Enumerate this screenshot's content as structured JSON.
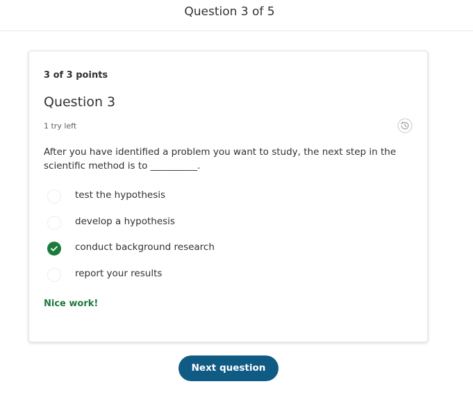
{
  "header": {
    "title": "Question 3 of 5"
  },
  "question": {
    "points": "3 of 3 points",
    "title": "Question 3",
    "tries": "1 try left",
    "prompt": "After you have identified a problem you want to study, the next step in the scientific method is to __________.",
    "history_icon": "history-icon",
    "options": [
      {
        "label": "test the hypothesis",
        "selected": false
      },
      {
        "label": "develop a hypothesis",
        "selected": false
      },
      {
        "label": "conduct background research",
        "selected": true
      },
      {
        "label": "report your results",
        "selected": false
      }
    ],
    "feedback": "Nice work!"
  },
  "footer": {
    "next_label": "Next question"
  },
  "colors": {
    "correct": "#1c7a3a",
    "primary_button": "#0f5b84",
    "text": "#323130"
  }
}
